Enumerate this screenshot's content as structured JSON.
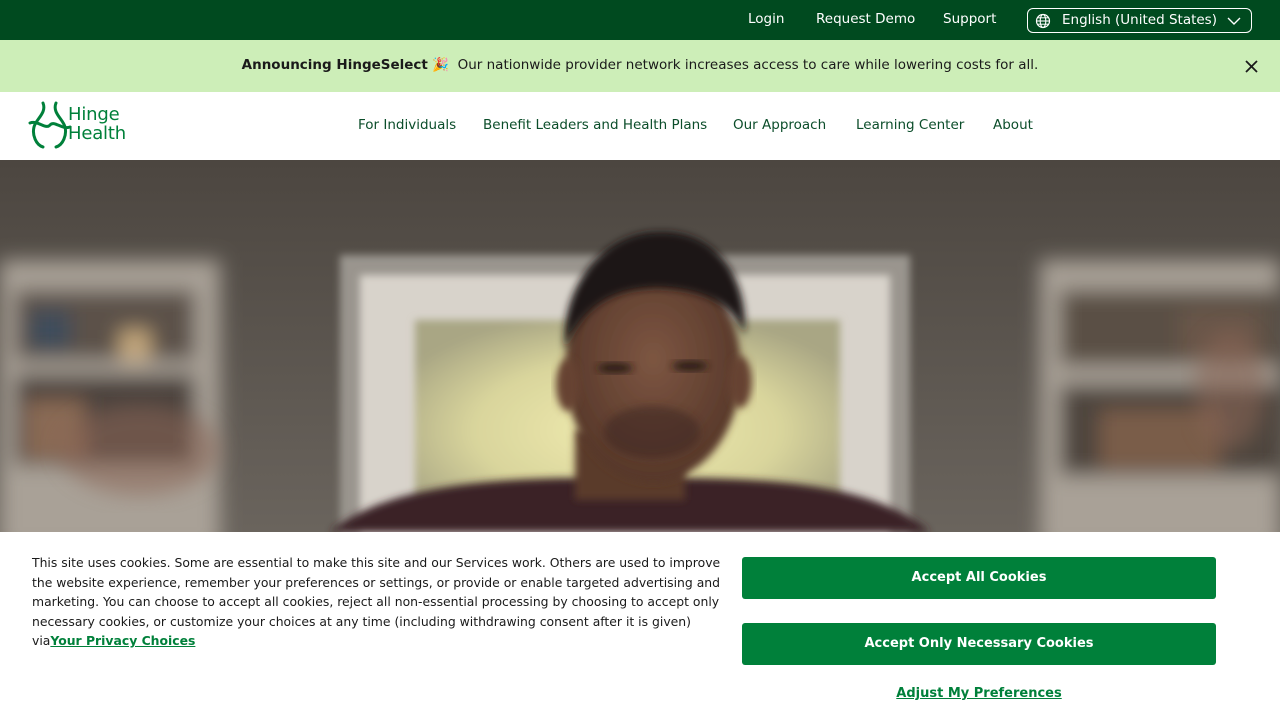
{
  "topbar": {
    "links": {
      "login": "Login",
      "request_demo": "Request Demo",
      "support": "Support"
    },
    "language": {
      "label": "English (United States)",
      "icon": "globe-icon"
    }
  },
  "announcement": {
    "bold": "Announcing HingeSelect",
    "emoji": "🎉",
    "text": "Our nationwide provider network increases access to care while lowering costs for all.",
    "close_icon": "close-icon"
  },
  "brand": {
    "line1": "Hinge",
    "line2": "Health",
    "color": "#00803a"
  },
  "nav": {
    "items": [
      "For Individuals",
      "Benefit Leaders and Health Plans",
      "Our Approach",
      "Learning Center",
      "About"
    ]
  },
  "cookie": {
    "text": "This site uses cookies. Some are essential to make this site and our Services work. Others are used to improve the website experience, remember your preferences or settings, or provide or enable targeted advertising and marketing. You can choose to accept all cookies, reject all non-essential processing by choosing to accept only necessary cookies, or customize your choices at any time (including withdrawing consent after it is given) via",
    "link": "Your Privacy Choices",
    "accept_all": "Accept All Cookies",
    "accept_necessary": "Accept Only Necessary Cookies",
    "adjust": "Adjust My Preferences"
  },
  "colors": {
    "topbar": "#004a1f",
    "announce": "#cdeeb8",
    "accent": "#00803a"
  }
}
